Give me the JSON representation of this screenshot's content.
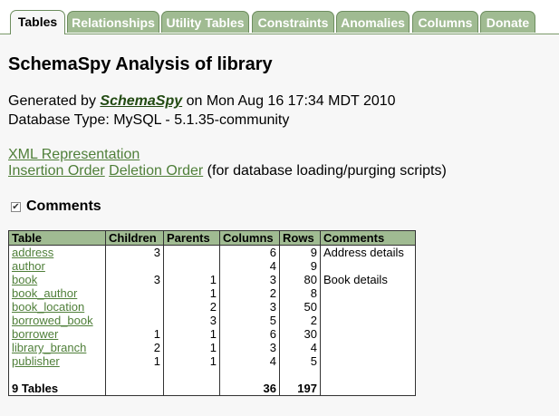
{
  "tabs": [
    {
      "label": "Tables",
      "active": true
    },
    {
      "label": "Relationships"
    },
    {
      "label": "Utility Tables"
    },
    {
      "label": "Constraints"
    },
    {
      "label": "Anomalies"
    },
    {
      "label": "Columns"
    },
    {
      "label": "Donate"
    }
  ],
  "title": "SchemaSpy Analysis of library",
  "generated": {
    "prefix": "Generated by ",
    "brand": "SchemaSpy",
    "suffix": " on Mon Aug 16 17:34 MDT 2010"
  },
  "db_type": "Database Type: MySQL - 5.1.35-community",
  "links": {
    "xml": "XML Representation",
    "insertion": "Insertion Order",
    "deletion": "Deletion Order",
    "note": " (for database loading/purging scripts)"
  },
  "comments_toggle": {
    "label": "Comments",
    "checked": true
  },
  "table": {
    "headers": [
      "Table",
      "Children",
      "Parents",
      "Columns",
      "Rows",
      "Comments"
    ],
    "rows": [
      {
        "name": "address",
        "children": "3",
        "parents": "",
        "columns": "6",
        "rows": "9",
        "comment": "Address details"
      },
      {
        "name": "author",
        "children": "",
        "parents": "",
        "columns": "4",
        "rows": "9",
        "comment": ""
      },
      {
        "name": "book",
        "children": "3",
        "parents": "1",
        "columns": "3",
        "rows": "80",
        "comment": "Book details"
      },
      {
        "name": "book_author",
        "children": "",
        "parents": "1",
        "columns": "2",
        "rows": "8",
        "comment": ""
      },
      {
        "name": "book_location",
        "children": "",
        "parents": "2",
        "columns": "3",
        "rows": "50",
        "comment": ""
      },
      {
        "name": "borrowed_book",
        "children": "",
        "parents": "3",
        "columns": "5",
        "rows": "2",
        "comment": ""
      },
      {
        "name": "borrower",
        "children": "1",
        "parents": "1",
        "columns": "6",
        "rows": "30",
        "comment": ""
      },
      {
        "name": "library_branch",
        "children": "2",
        "parents": "1",
        "columns": "3",
        "rows": "4",
        "comment": ""
      },
      {
        "name": "publisher",
        "children": "1",
        "parents": "1",
        "columns": "4",
        "rows": "5",
        "comment": ""
      }
    ],
    "footer": {
      "label": "9 Tables",
      "columns": "36",
      "rows": "197"
    }
  }
}
